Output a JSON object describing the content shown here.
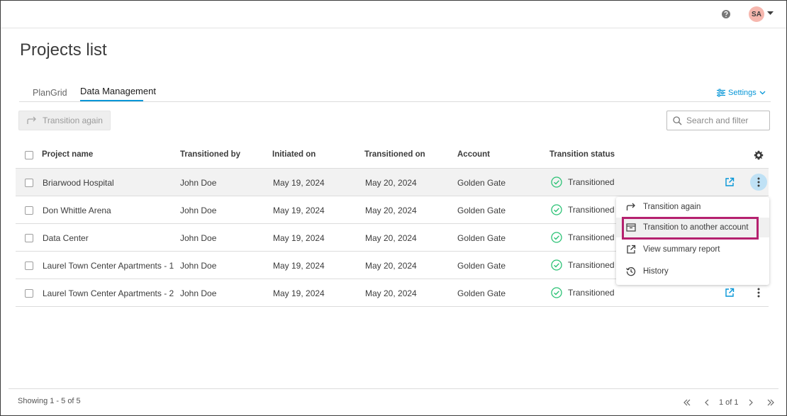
{
  "header": {
    "help_icon": "help-circle-icon",
    "avatar_initials": "SA",
    "avatar_color": "#f6b7ae"
  },
  "page": {
    "title": "Projects list"
  },
  "tabs": [
    {
      "label": "PlanGrid",
      "active": false
    },
    {
      "label": "Data Management",
      "active": true
    }
  ],
  "settings_label": "Settings",
  "toolbar": {
    "transition_again_label": "Transition again",
    "search_placeholder": "Search and filter"
  },
  "table": {
    "columns": [
      "Project name",
      "Transitioned by",
      "Initiated on",
      "Transitioned on",
      "Account",
      "Transition status"
    ],
    "rows": [
      {
        "name": "Briarwood Hospital",
        "by": "John Doe",
        "initiated": "May 19, 2024",
        "transitioned": "May 20, 2024",
        "account": "Golden Gate",
        "status": "Transitioned"
      },
      {
        "name": "Don Whittle Arena",
        "by": "John Doe",
        "initiated": "May 19, 2024",
        "transitioned": "May 20, 2024",
        "account": "Golden Gate",
        "status": "Transitioned"
      },
      {
        "name": "Data Center",
        "by": "John Doe",
        "initiated": "May 19, 2024",
        "transitioned": "May 20, 2024",
        "account": "Golden Gate",
        "status": "Transitioned"
      },
      {
        "name": "Laurel Town Center Apartments - 1",
        "by": "John Doe",
        "initiated": "May 19, 2024",
        "transitioned": "May 20, 2024",
        "account": "Golden Gate",
        "status": "Transitioned"
      },
      {
        "name": "Laurel Town Center Apartments - 2",
        "by": "John Doe",
        "initiated": "May 19, 2024",
        "transitioned": "May 20, 2024",
        "account": "Golden Gate",
        "status": "Transitioned"
      }
    ]
  },
  "context_menu": {
    "items": [
      {
        "label": "Transition again",
        "icon": "redo-arrow-icon"
      },
      {
        "label": "Transition to another account",
        "icon": "archive-box-icon"
      },
      {
        "label": "View summary report",
        "icon": "external-link-icon"
      },
      {
        "label": "History",
        "icon": "history-icon"
      }
    ]
  },
  "footer": {
    "showing": "Showing 1 - 5 of 5",
    "page_label": "1 of 1"
  },
  "colors": {
    "accent": "#0696d7",
    "status_ok": "#2bc275",
    "highlight_border": "#b5216f"
  }
}
